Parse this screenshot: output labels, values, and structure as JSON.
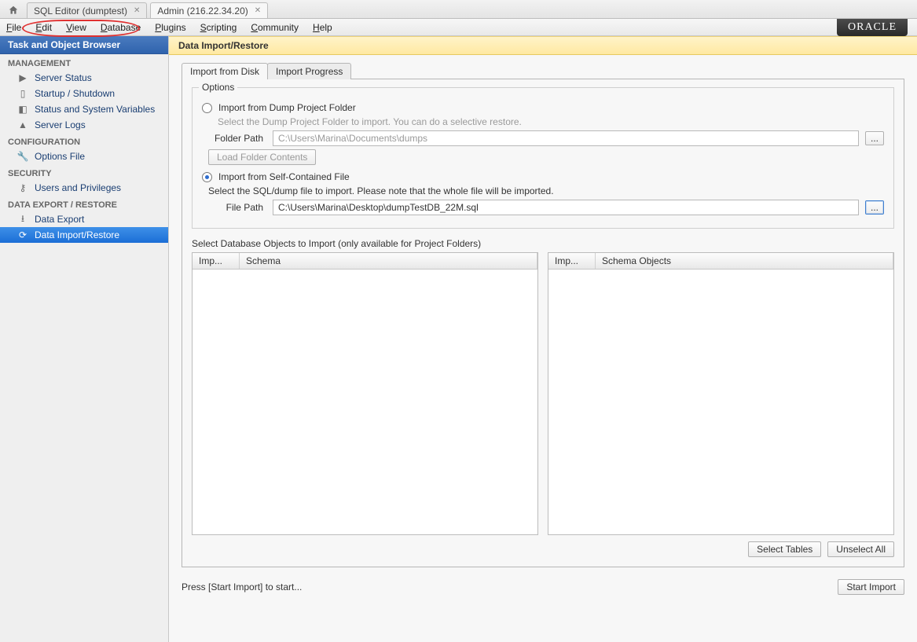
{
  "tabs": [
    {
      "label": "SQL Editor (dumptest)",
      "active": false
    },
    {
      "label": "Admin (216.22.34.20)",
      "active": true
    }
  ],
  "brand": "ORACLE",
  "menu": [
    "File",
    "Edit",
    "View",
    "Database",
    "Plugins",
    "Scripting",
    "Community",
    "Help"
  ],
  "sidebar": {
    "title": "Task and Object Browser",
    "groups": [
      {
        "name": "MANAGEMENT",
        "items": [
          {
            "label": "Server Status",
            "icon": "play"
          },
          {
            "label": "Startup / Shutdown",
            "icon": "server"
          },
          {
            "label": "Status and System Variables",
            "icon": "gauge"
          },
          {
            "label": "Server Logs",
            "icon": "warn"
          }
        ]
      },
      {
        "name": "CONFIGURATION",
        "items": [
          {
            "label": "Options File",
            "icon": "wrench"
          }
        ]
      },
      {
        "name": "SECURITY",
        "items": [
          {
            "label": "Users and Privileges",
            "icon": "key"
          }
        ]
      },
      {
        "name": "DATA EXPORT / RESTORE",
        "items": [
          {
            "label": "Data Export",
            "icon": "down"
          },
          {
            "label": "Data Import/Restore",
            "icon": "restore",
            "selected": true
          }
        ]
      }
    ]
  },
  "page": {
    "title": "Data Import/Restore",
    "tabs": [
      "Import from Disk",
      "Import Progress"
    ],
    "options": {
      "group_title": "Options",
      "opt1_label": "Import from Dump Project Folder",
      "opt1_hint": "Select the Dump Project Folder to import. You can do a selective restore.",
      "folder_label": "Folder Path",
      "folder_value": "C:\\Users\\Marina\\Documents\\dumps",
      "load_folder_btn": "Load Folder Contents",
      "opt2_label": "Import from Self-Contained File",
      "opt2_hint": "Select the SQL/dump file to import. Please note that the whole file will be imported.",
      "file_label": "File Path",
      "file_value": "C:\\Users\\Marina\\Desktop\\dumpTestDB_22M.sql",
      "browse": "..."
    },
    "objects": {
      "title": "Select Database Objects to Import (only available for Project Folders)",
      "left_cols": [
        "Imp...",
        "Schema"
      ],
      "right_cols": [
        "Imp...",
        "Schema Objects"
      ]
    },
    "actions": {
      "select_tables": "Select Tables",
      "unselect_all": "Unselect All"
    },
    "footer_hint": "Press [Start Import] to start...",
    "start_btn": "Start Import"
  }
}
